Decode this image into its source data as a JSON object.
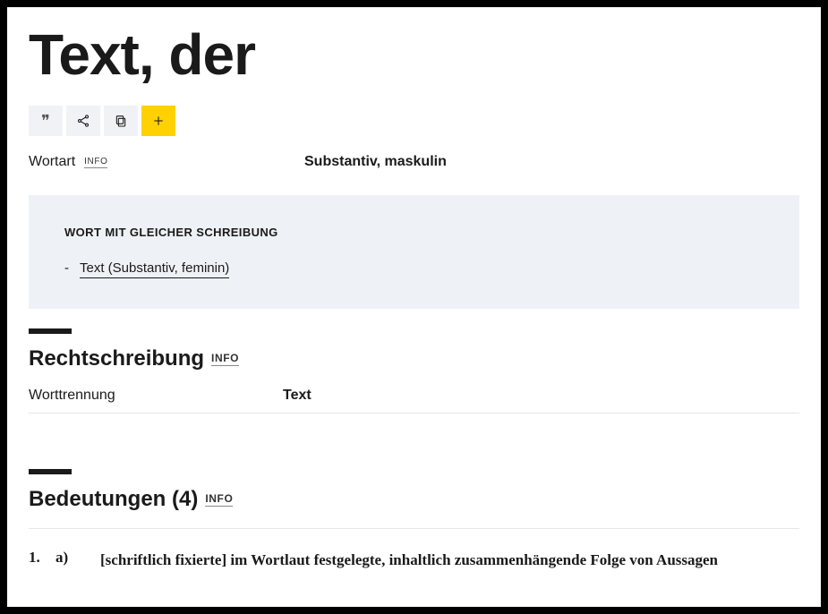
{
  "headword": "Text, der",
  "actions": {
    "quote_glyph": "❞"
  },
  "meta": {
    "wortart_label": "Wortart",
    "wortart_info": "INFO",
    "wortart_value": "Substantiv, maskulin"
  },
  "callout": {
    "title": "WORT MIT GLEICHER SCHREIBUNG",
    "items": [
      {
        "bullet": "-",
        "text": "Text (Substantiv, feminin)"
      }
    ]
  },
  "spelling": {
    "heading": "Rechtschreibung",
    "info": "INFO",
    "worttrennung_label": "Worttrennung",
    "worttrennung_value": "Text"
  },
  "meanings": {
    "heading": "Bedeutungen (4)",
    "info": "INFO",
    "items": [
      {
        "num": "1.",
        "sub": "a)",
        "text": "[schriftlich fixierte] im Wortlaut festgelegte, inhaltlich zusammenhängende Folge von Aussagen"
      }
    ]
  }
}
